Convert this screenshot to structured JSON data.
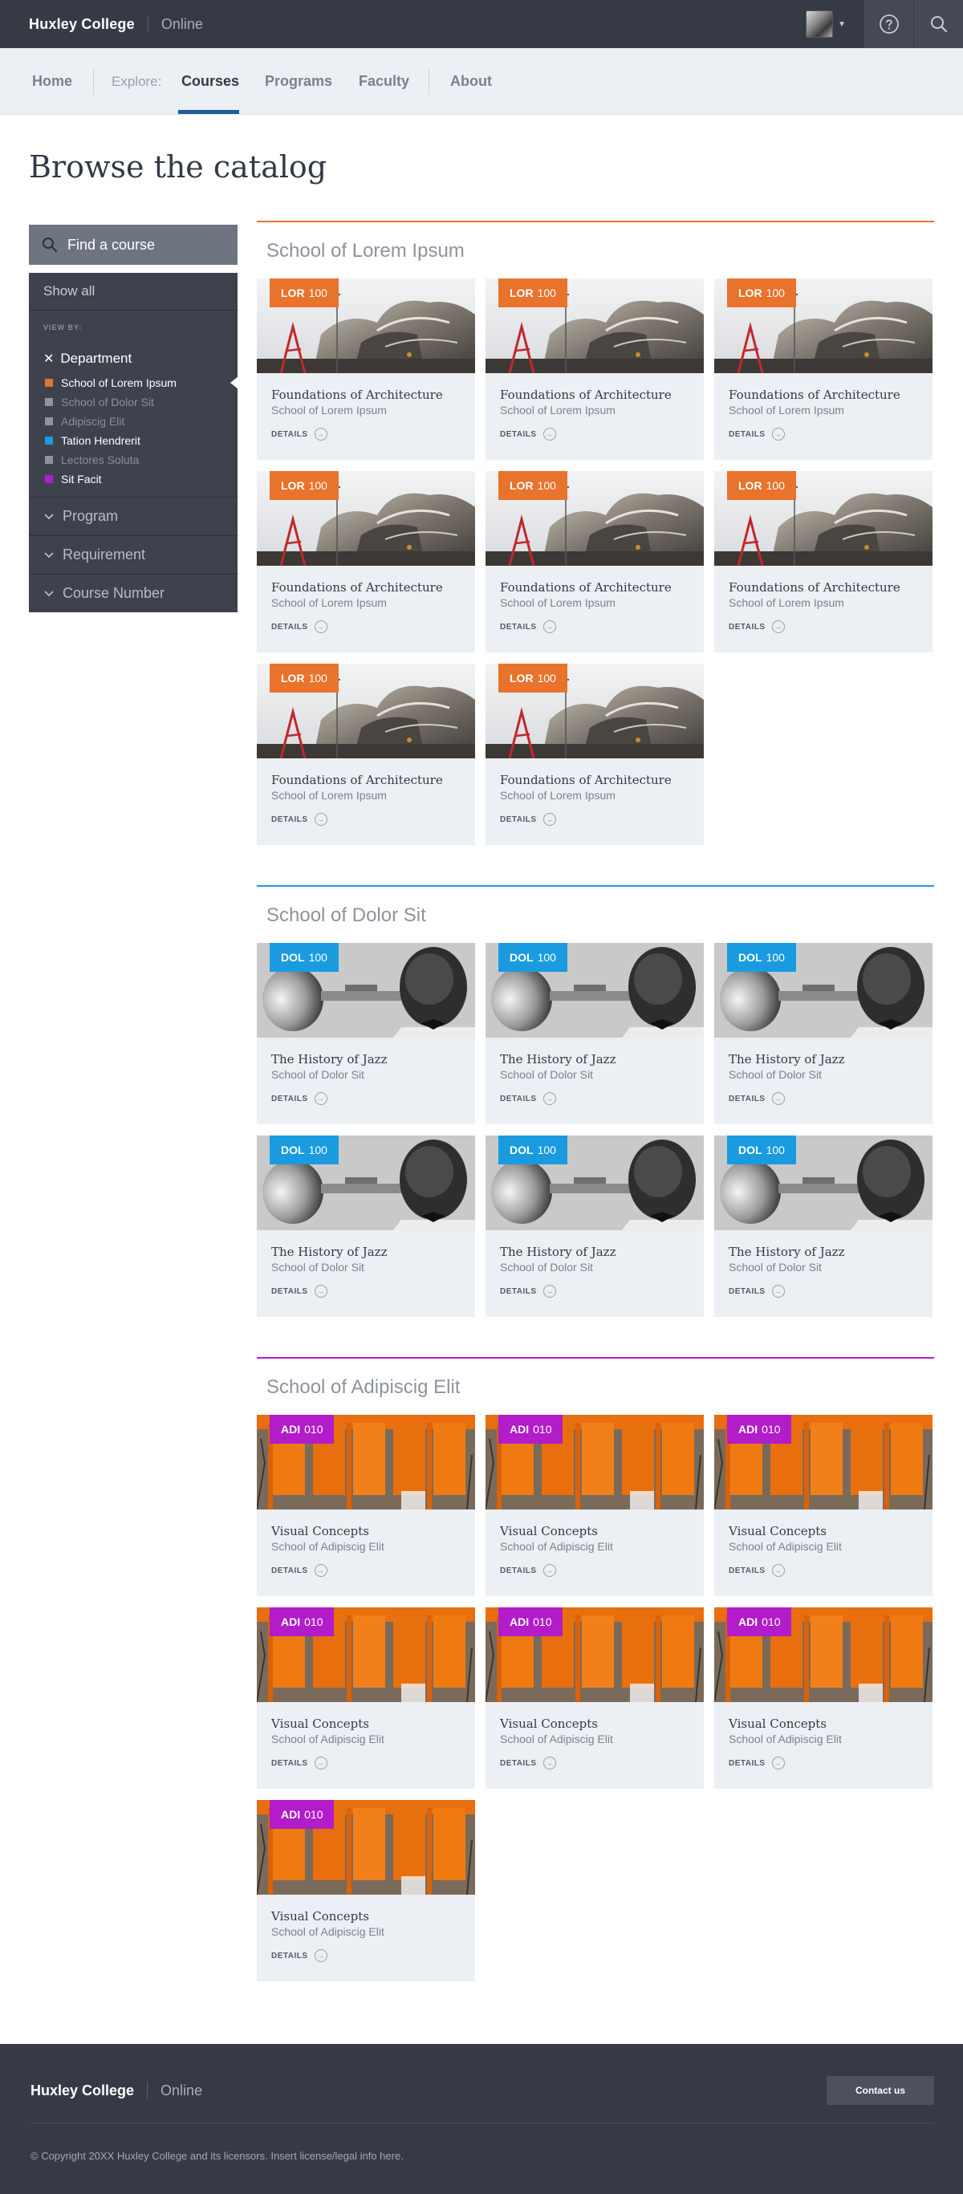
{
  "header": {
    "brand": "Huxley College",
    "brand_sub": "Online",
    "avatar_alt": "User avatar"
  },
  "nav": {
    "home": "Home",
    "explore_label": "Explore:",
    "items": [
      {
        "label": "Courses",
        "active": true
      },
      {
        "label": "Programs",
        "active": false
      },
      {
        "label": "Faculty",
        "active": false
      }
    ],
    "about": "About"
  },
  "page": {
    "title": "Browse the catalog"
  },
  "sidebar": {
    "search_label": "Find a course",
    "show_all": "Show all",
    "view_by": "VIEW BY:",
    "department_heading": "Department",
    "departments": [
      {
        "label": "School of Lorem Ipsum",
        "color": "#e8732c",
        "selected": true
      },
      {
        "label": "School of Dolor Sit",
        "color": "#8e939c",
        "selected": false
      },
      {
        "label": "Adipiscig Elit",
        "color": "#8e939c",
        "selected": false
      },
      {
        "label": "Tation Hendrerit",
        "color": "#1a9be0",
        "selected": true
      },
      {
        "label": "Lectores Soluta",
        "color": "#8e939c",
        "selected": false
      },
      {
        "label": "Sit Facit",
        "color": "#b21cc9",
        "selected": true
      }
    ],
    "facets": [
      "Program",
      "Requirement",
      "Course Number"
    ]
  },
  "sections": [
    {
      "title": "School of Lorem Ipsum",
      "color": "#e8732c",
      "image": "architecture",
      "card": {
        "code": "LOR",
        "number": "100",
        "title": "Foundations of Architecture",
        "school": "School of Lorem Ipsum",
        "details": "DETAILS"
      },
      "count": 8
    },
    {
      "title": "School of Dolor Sit",
      "color": "#1a9be0",
      "image": "jazz",
      "card": {
        "code": "DOL",
        "number": "100",
        "title": "The History of Jazz",
        "school": "School of Dolor Sit",
        "details": "DETAILS"
      },
      "count": 6
    },
    {
      "title": "School of Adipiscig Elit",
      "color": "#b21cc9",
      "image": "gates",
      "card": {
        "code": "ADI",
        "number": "010",
        "title": "Visual Concepts",
        "school": "School of Adipiscig Elit",
        "details": "DETAILS"
      },
      "count": 7
    }
  ],
  "footer": {
    "brand": "Huxley College",
    "brand_sub": "Online",
    "contact": "Contact us",
    "copyright": "© Copyright 20XX Huxley College and its licensors. Insert license/legal info here."
  }
}
